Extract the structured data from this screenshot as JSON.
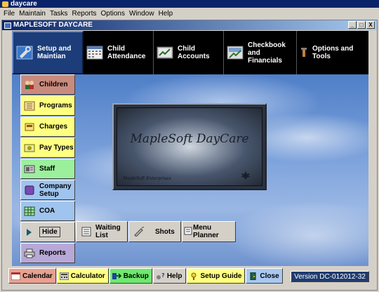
{
  "app_title": "daycare",
  "menu": [
    "File",
    "Maintain",
    "Tasks",
    "Reports",
    "Options",
    "Window",
    "Help"
  ],
  "window": {
    "title": "MAPLESOFT DAYCARE",
    "buttons": [
      "_",
      "□",
      "X"
    ]
  },
  "top_nav": [
    {
      "label": "Setup and Maintian",
      "icon": "wrench-icon",
      "active": true
    },
    {
      "label": "Child Attendance",
      "icon": "calendar-icon",
      "active": false
    },
    {
      "label": "Child Accounts",
      "icon": "ledger-icon",
      "active": false
    },
    {
      "label": "Checkbook and Financials",
      "icon": "checkbook-icon",
      "active": false
    },
    {
      "label": "Options and Tools",
      "icon": "tools-icon",
      "active": false
    }
  ],
  "sidebar": [
    {
      "label": "Children",
      "color": "#c98b7d"
    },
    {
      "label": "Programs",
      "color": "#ffff80"
    },
    {
      "label": "Charges",
      "color": "#ffff80"
    },
    {
      "label": "Pay Types",
      "color": "#ffff80"
    },
    {
      "label": "Staff",
      "color": "#9cf09c"
    },
    {
      "label": "Company Setup",
      "color": "#9fc4ee"
    },
    {
      "label": "COA",
      "color": "#9fc4ee"
    },
    {
      "label": "Hide",
      "color": "#d4d0c8"
    },
    {
      "label": "Reports",
      "color": "#b8a8d8"
    }
  ],
  "logo": {
    "title": "MapleSoft DayCare",
    "subtitle": "MapleSoft Enterprises"
  },
  "sub_buttons": [
    {
      "label": "Waiting List",
      "icon": "list-icon"
    },
    {
      "label": "Shots",
      "icon": "syringe-icon"
    },
    {
      "label": "Menu Planner",
      "icon": "menu-icon"
    }
  ],
  "bottom_toolbar": [
    {
      "label": "Calendar",
      "color": "#e8a090",
      "icon": "calendar-icon"
    },
    {
      "label": "Calculator",
      "color": "#ffff80",
      "icon": "calculator-icon"
    },
    {
      "label": "Backup",
      "color": "#6ee86e",
      "icon": "backup-icon"
    },
    {
      "label": "Help",
      "color": "#d4d0c8",
      "icon": "help-icon"
    },
    {
      "label": "Setup Guide",
      "color": "#ffff80",
      "icon": "guide-icon"
    },
    {
      "label": "Close",
      "color": "#a8c8f0",
      "icon": "close-icon"
    }
  ],
  "version": "Version DC-012012-32"
}
